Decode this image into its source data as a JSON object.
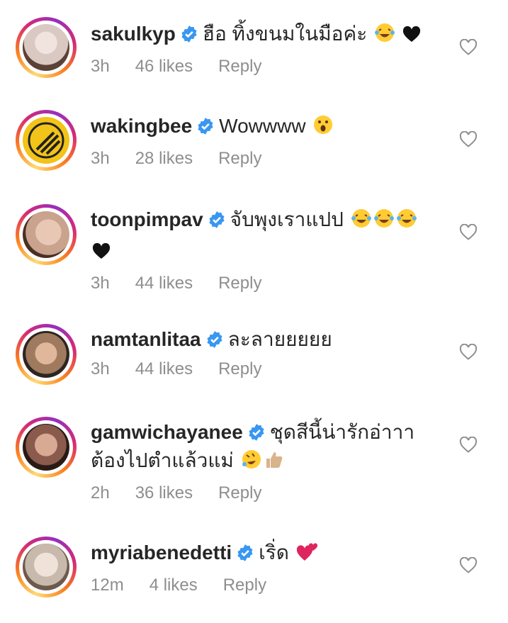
{
  "comments": [
    {
      "username": "sakulkyp",
      "text": "ฮือ ทิ้งขนมในมือค่ะ",
      "emojis": [
        "laugh-cry",
        "heart"
      ],
      "time": "3h",
      "likes": "46 likes",
      "reply": "Reply",
      "avatar_color": "#d9c9c2"
    },
    {
      "username": "wakingbee",
      "text": "Wowwww",
      "emojis": [
        "surprised"
      ],
      "time": "3h",
      "likes": "28 likes",
      "reply": "Reply",
      "avatar_color": "#f2c318"
    },
    {
      "username": "toonpimpav",
      "text": "จับพุงเราแปป",
      "emojis": [
        "laugh-cry",
        "laugh-cry",
        "laugh-cry",
        "heart"
      ],
      "time": "3h",
      "likes": "44 likes",
      "reply": "Reply",
      "avatar_color": "#c9a38d"
    },
    {
      "username": "namtanlitaa",
      "text": "ละลายยยยย",
      "emojis": [],
      "time": "3h",
      "likes": "44 likes",
      "reply": "Reply",
      "avatar_color": "#a07a5e"
    },
    {
      "username": "gamwichayanee",
      "text": "ชุดสีนี้น่ารักอ่าาา ต้องไปตำแล้วแม่",
      "emojis": [
        "rofl",
        "thumbs-up"
      ],
      "time": "2h",
      "likes": "36 likes",
      "reply": "Reply",
      "avatar_color": "#8a5a4c"
    },
    {
      "username": "myriabenedetti",
      "text": "เริ่ด",
      "emojis": [
        "two-hearts"
      ],
      "time": "12m",
      "likes": "4 likes",
      "reply": "Reply",
      "avatar_color": "#c8b9ad"
    }
  ],
  "colors": {
    "verified": "#3897f0",
    "muted": "#8e8e8e",
    "text": "#262626"
  }
}
